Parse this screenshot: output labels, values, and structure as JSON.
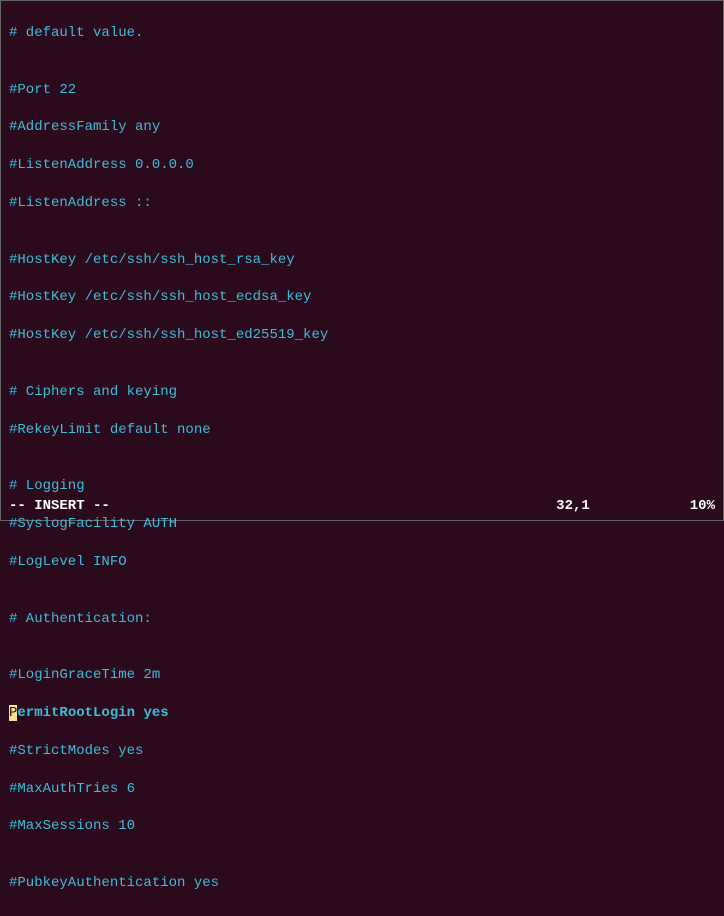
{
  "lines": {
    "l0": "# default value.",
    "l1": "",
    "l2": "#Port 22",
    "l3": "#AddressFamily any",
    "l4": "#ListenAddress 0.0.0.0",
    "l5": "#ListenAddress ::",
    "l6": "",
    "l7": "#HostKey /etc/ssh/ssh_host_rsa_key",
    "l8": "#HostKey /etc/ssh/ssh_host_ecdsa_key",
    "l9": "#HostKey /etc/ssh/ssh_host_ed25519_key",
    "l10": "",
    "l11": "# Ciphers and keying",
    "l12": "#RekeyLimit default none",
    "l13": "",
    "l14": "# Logging",
    "l15": "#SyslogFacility AUTH",
    "l16": "#LogLevel INFO",
    "l17": "",
    "l18": "# Authentication:",
    "l19": "",
    "l20": "#LoginGraceTime 2m",
    "cursor_char": "P",
    "active_rest": "ermitRootLogin ",
    "active_val": "yes",
    "l22": "#StrictModes yes",
    "l23": "#MaxAuthTries 6",
    "l24": "#MaxSessions 10",
    "l25": "",
    "l26": "#PubkeyAuthentication yes"
  },
  "status": {
    "mode": "-- INSERT --",
    "position": "32,1",
    "percent": "10%"
  }
}
